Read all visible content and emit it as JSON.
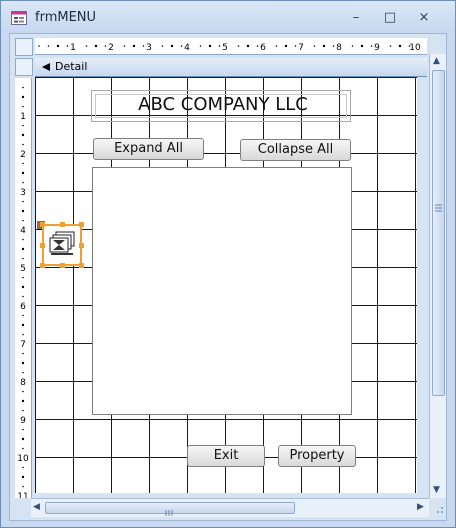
{
  "window": {
    "title": "frmMENU",
    "controls": {
      "minimize": "–",
      "maximize": "□",
      "close": "×"
    }
  },
  "section": {
    "label": "Detail"
  },
  "rulers": {
    "top_labels": [
      "1",
      "2",
      "3",
      "4",
      "5",
      "6",
      "7",
      "8",
      "9",
      "10"
    ],
    "left_labels": [
      "1",
      "2",
      "3",
      "4",
      "5",
      "6",
      "7",
      "8",
      "9",
      "10",
      "11"
    ]
  },
  "form": {
    "company_label": "ABC COMPANY LLC",
    "buttons": {
      "expand": "Expand All",
      "collapse": "Collapse All",
      "exit": "Exit",
      "property": "Property"
    }
  },
  "colors": {
    "selection": "#f0a030",
    "chrome": "#c9daf0",
    "grid": "#1a1a1a"
  },
  "icons": {
    "app": "form-icon",
    "object": "image-control-icon"
  }
}
